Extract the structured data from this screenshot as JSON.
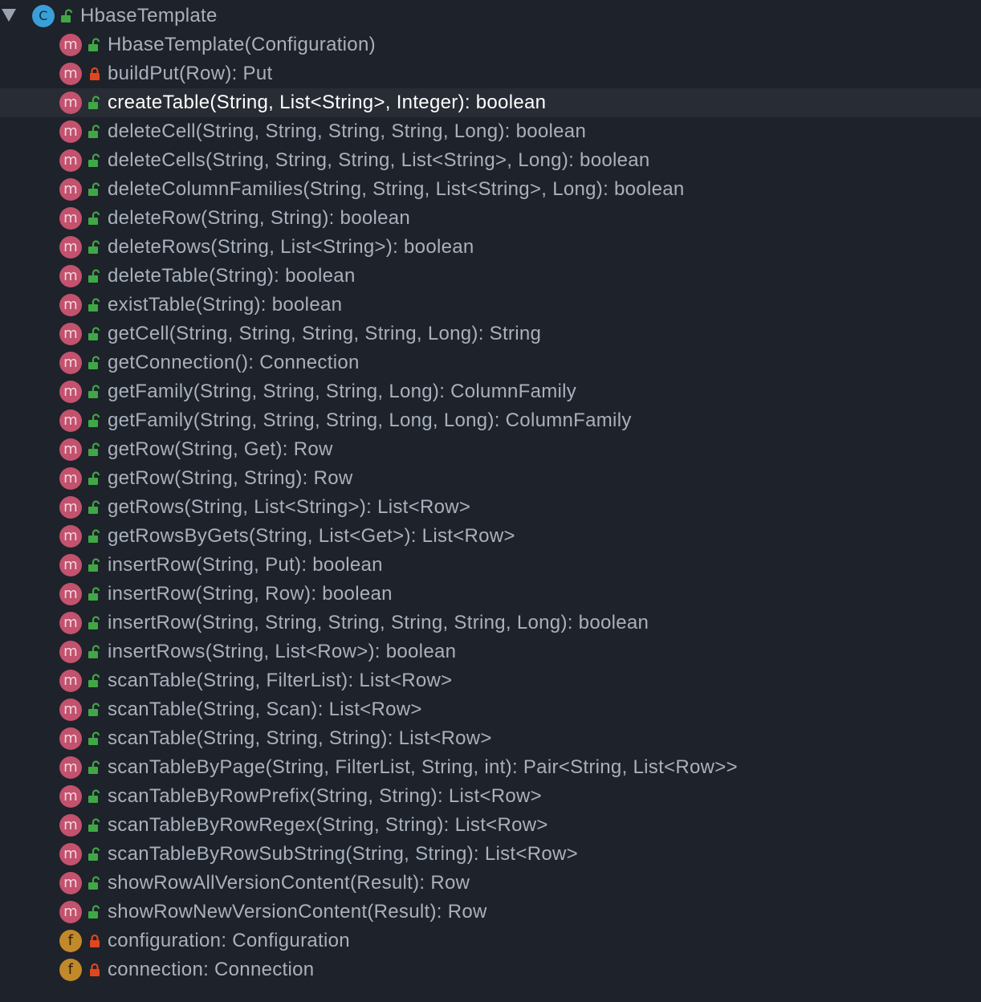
{
  "tree": {
    "root": {
      "label": "HbaseTemplate",
      "kind_icon": "class-icon",
      "visibility": "public"
    },
    "members": [
      {
        "label": "HbaseTemplate(Configuration)",
        "kind": "method",
        "visibility": "public"
      },
      {
        "label": "buildPut(Row): Put",
        "kind": "method",
        "visibility": "private"
      },
      {
        "label": "createTable(String, List<String>, Integer): boolean",
        "kind": "method",
        "visibility": "public",
        "selected": true
      },
      {
        "label": "deleteCell(String, String, String, String, Long): boolean",
        "kind": "method",
        "visibility": "public"
      },
      {
        "label": "deleteCells(String, String, String, List<String>, Long): boolean",
        "kind": "method",
        "visibility": "public"
      },
      {
        "label": "deleteColumnFamilies(String, String, List<String>, Long): boolean",
        "kind": "method",
        "visibility": "public"
      },
      {
        "label": "deleteRow(String, String): boolean",
        "kind": "method",
        "visibility": "public"
      },
      {
        "label": "deleteRows(String, List<String>): boolean",
        "kind": "method",
        "visibility": "public"
      },
      {
        "label": "deleteTable(String): boolean",
        "kind": "method",
        "visibility": "public"
      },
      {
        "label": "existTable(String): boolean",
        "kind": "method",
        "visibility": "public"
      },
      {
        "label": "getCell(String, String, String, String, Long): String",
        "kind": "method",
        "visibility": "public"
      },
      {
        "label": "getConnection(): Connection",
        "kind": "method",
        "visibility": "public"
      },
      {
        "label": "getFamily(String, String, String, Long): ColumnFamily",
        "kind": "method",
        "visibility": "public"
      },
      {
        "label": "getFamily(String, String, String, Long, Long): ColumnFamily",
        "kind": "method",
        "visibility": "public"
      },
      {
        "label": "getRow(String, Get): Row",
        "kind": "method",
        "visibility": "public"
      },
      {
        "label": "getRow(String, String): Row",
        "kind": "method",
        "visibility": "public"
      },
      {
        "label": "getRows(String, List<String>): List<Row>",
        "kind": "method",
        "visibility": "public"
      },
      {
        "label": "getRowsByGets(String, List<Get>): List<Row>",
        "kind": "method",
        "visibility": "public"
      },
      {
        "label": "insertRow(String, Put): boolean",
        "kind": "method",
        "visibility": "public"
      },
      {
        "label": "insertRow(String, Row): boolean",
        "kind": "method",
        "visibility": "public"
      },
      {
        "label": "insertRow(String, String, String, String, String, Long): boolean",
        "kind": "method",
        "visibility": "public"
      },
      {
        "label": "insertRows(String, List<Row>): boolean",
        "kind": "method",
        "visibility": "public"
      },
      {
        "label": "scanTable(String, FilterList): List<Row>",
        "kind": "method",
        "visibility": "public"
      },
      {
        "label": "scanTable(String, Scan): List<Row>",
        "kind": "method",
        "visibility": "public"
      },
      {
        "label": "scanTable(String, String, String): List<Row>",
        "kind": "method",
        "visibility": "public"
      },
      {
        "label": "scanTableByPage(String, FilterList, String, int): Pair<String, List<Row>>",
        "kind": "method",
        "visibility": "public"
      },
      {
        "label": "scanTableByRowPrefix(String, String): List<Row>",
        "kind": "method",
        "visibility": "public"
      },
      {
        "label": "scanTableByRowRegex(String, String): List<Row>",
        "kind": "method",
        "visibility": "public"
      },
      {
        "label": "scanTableByRowSubString(String, String): List<Row>",
        "kind": "method",
        "visibility": "public"
      },
      {
        "label": "showRowAllVersionContent(Result): Row",
        "kind": "method",
        "visibility": "public"
      },
      {
        "label": "showRowNewVersionContent(Result): Row",
        "kind": "method",
        "visibility": "public"
      },
      {
        "label": "configuration: Configuration",
        "kind": "field",
        "visibility": "private"
      },
      {
        "label": "connection: Connection",
        "kind": "field",
        "visibility": "private"
      }
    ]
  },
  "icons": {
    "class_letter": "C",
    "method_letter": "m",
    "field_letter": "f"
  },
  "colors": {
    "background": "#1e222a",
    "selected_row": "#282c34",
    "text": "#a9b1bc",
    "selected_text": "#ffffff",
    "class_badge": "#3a9fd8",
    "method_badge": "#c2526e",
    "field_badge": "#c1892a",
    "public_lock": "#3fa845",
    "private_lock": "#e0461f"
  }
}
